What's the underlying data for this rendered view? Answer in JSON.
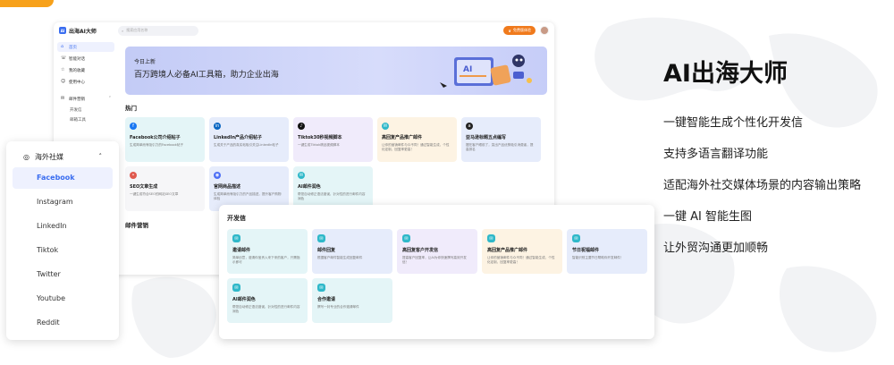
{
  "app": {
    "logo_text": "出海AI大师",
    "search_placeholder": "搜索应用名称",
    "trial_button": "免费版体验",
    "sidebar": {
      "items": [
        {
          "label": "首页",
          "icon": "home-icon",
          "active": true
        },
        {
          "label": "智能对话",
          "icon": "chat-icon",
          "active": false
        },
        {
          "label": "我的收藏",
          "icon": "star-icon",
          "active": false
        },
        {
          "label": "使用中心",
          "icon": "user-icon",
          "active": false
        },
        {
          "label": "邮件营销",
          "icon": "mail-icon",
          "active": false
        }
      ],
      "sub_items": [
        "开发信",
        "邮箱工具"
      ]
    },
    "banner": {
      "line1": "今日上新",
      "line2": "百万跨境人必备AI工具箱，助力企业出海",
      "ai_badge": "AI"
    },
    "hot_title": "热门",
    "hot_cards": [
      {
        "title": "Facebook公司介绍帖子",
        "desc": "生成简单而有吸引力的Facebook帖子",
        "bg": "#e4f5f7",
        "icon_color": "#1877f2",
        "icon": "f"
      },
      {
        "title": "LinkedIn产品介绍帖子",
        "desc": "生成关于产品的真实帖吸引关注LinkedIn帖子",
        "bg": "#e6ecfb",
        "icon_color": "#0a66c2",
        "icon": "in"
      },
      {
        "title": "Tiktok30秒视频脚本",
        "desc": "一键生成Tiktok精品视频脚本",
        "bg": "#f0ebfb",
        "icon_color": "#111111",
        "icon": "♪"
      },
      {
        "title": "高回复产品推广邮件",
        "desc": "让你的营销邮件与众不同！通过智能生成，个性化定制，回复率更高！",
        "bg": "#fdf3e3",
        "icon_color": "#2fb8c9",
        "icon": "✉"
      },
      {
        "title": "亚马逊标题五点编写",
        "desc": "摆在客户眼前了，突出产品优势吸引消费者，提高排名",
        "bg": "#e6ecfb",
        "icon_color": "#222222",
        "icon": "a"
      },
      {
        "title": "SEO文章生成",
        "desc": "一键生成符合SEO的网站SEO文章",
        "bg": "#f6f6f8",
        "icon_color": "#e05a4f",
        "icon": "•"
      },
      {
        "title": "官网商品描述",
        "desc": "生成简单而有吸引力的产品描述，提升客户购物体验",
        "bg": "#e6ecfb",
        "icon_color": "#4c6ef5",
        "icon": "◉"
      },
      {
        "title": "AI邮件润色",
        "desc": "帮您自动修正语法错误，针对性的进行邮件内容润色",
        "bg": "#e4f5f7",
        "icon_color": "#2fb8c9",
        "icon": "✉"
      }
    ],
    "email_section_title": "邮件营销"
  },
  "social_panel": {
    "title": "海外社媒",
    "items": [
      "Facebook",
      "Instagram",
      "LinkedIn",
      "Tiktok",
      "Twitter",
      "Youtube",
      "Reddit"
    ],
    "active": "Facebook"
  },
  "dev_panel": {
    "title": "开发信",
    "cards": [
      {
        "title": "邀请邮件",
        "desc": "简单创意，邀请你宝贵入来下来的客户，只需指示即可",
        "bg": "#e4f5f7"
      },
      {
        "title": "邮件回复",
        "desc": "根据客户邮件智能生成回复邮件",
        "bg": "#e6ecfb"
      },
      {
        "title": "高回复客户开发信",
        "desc": "提高客户回复率，让AI为你快速撰写高效开发信！",
        "bg": "#f0ebfb"
      },
      {
        "title": "高回复产品推广邮件",
        "desc": "让你的营销邮件与众不同！通过智能生成，个性化定制，回复率更高！",
        "bg": "#fdf3e3"
      },
      {
        "title": "节日祝福邮件",
        "desc": "智能识别主要节日帮助你开发邮件！",
        "bg": "#e6ecfb"
      },
      {
        "title": "AI邮件润色",
        "desc": "帮您自动修正语法错误，针对性的进行邮件内容润色",
        "bg": "#e4f5f7"
      },
      {
        "title": "合作邀请",
        "desc": "撰写一封专业的合作邀请邮件",
        "bg": "#e4f5f7"
      }
    ]
  },
  "features": {
    "title": "AI出海大师",
    "items": [
      "一键智能生成个性化开发信",
      "支持多语言翻译功能",
      "适配海外社交媒体场景的内容输出策略",
      "一键 AI 智能生图",
      "让外贸沟通更加顺畅"
    ]
  }
}
